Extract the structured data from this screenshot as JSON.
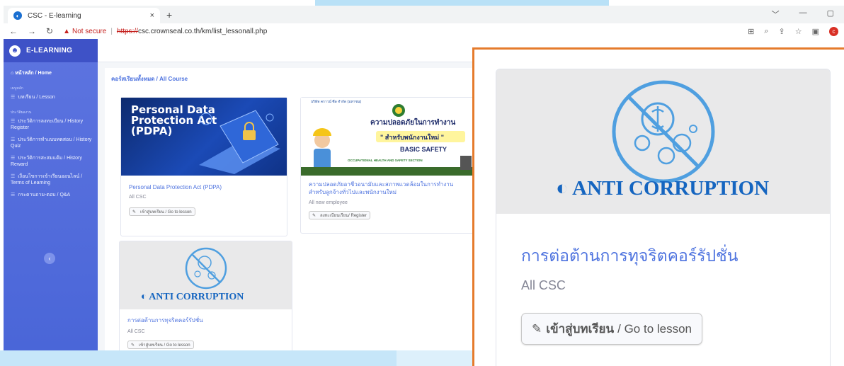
{
  "browser": {
    "tab_title": "CSC - E-learning",
    "tab_close": "×",
    "new_tab": "+",
    "win_controls": [
      "﹀",
      "—",
      "▢"
    ],
    "not_secure": "Not secure",
    "url_scheme": "https://",
    "url_rest": "csc.crownseal.co.th/km/list_lessonall.php",
    "profile_initial": "c"
  },
  "sidebar": {
    "brand": "E-LEARNING",
    "home": "หน้าหลัก / Home",
    "section_main": "เมนูหลัก",
    "lesson": "บทเรียน / Lesson",
    "section_history": "ประวัติผลงาน",
    "history_register": "ประวัติการลงทะเบียน / History Register",
    "history_quiz": "ประวัติการทำแบบทดสอบ / History Quiz",
    "history_reward": "ประวัติการสะสมแต้ม / History Reward",
    "terms": "เงื่อนไขการเข้าเรียนออนไลน์ / Terms of Learning",
    "qa": "กระดานถาม-ตอบ / Q&A",
    "collapse": "‹"
  },
  "breadcrumb": "คอร์สเรียนทั้งหมด / All Course",
  "courses": [
    {
      "thumb_lines": [
        "Personal Data",
        "Protection Act",
        "(PDPA)"
      ],
      "title": "Personal Data Protection Act (PDPA)",
      "audience": "All CSC",
      "button": "เข้าสู่บทเรียน / Go to lesson"
    },
    {
      "thumb_company": "บริษัท คราวน์ ซีล จำกัด (มหาชน)",
      "thumb_heading": "ความปลอดภัยในการทำงาน",
      "thumb_sub": "\" สำหรับพนักงานใหม่ \"",
      "thumb_basic": "BASIC SAFETY",
      "thumb_section": "OCCUPATIONAL HEALTH AND SAFETY SECTION",
      "title": "ความปลอดภัยอาชีวอนามัยและสภาพแวดล้อมในการทำงานสำหรับลูกจ้างทั่วไปและพนักงานใหม่",
      "audience": "All new employee",
      "button": "ลงทะเบียนเรียน/ Register"
    },
    {
      "thumb_label": "ANTI CORRUPTION",
      "title": "การต่อต้านการทุจริตคอร์รัปชั่น",
      "audience": "All CSC",
      "button": "เข้าสู่บทเรียน / Go to lesson"
    }
  ],
  "zoom": {
    "thumb_label": "ANTI CORRUPTION",
    "title": "การต่อต้านการทุจริตคอร์รัปชั่น",
    "audience": "All CSC",
    "button_thai": "เข้าสู่บทเรียน",
    "button_en": "/ Go to lesson"
  },
  "colors": {
    "accent": "#4e73df",
    "sidebar": "#4e66d8",
    "callout_border": "#e57b2c",
    "anti_blue": "#1565c0"
  }
}
